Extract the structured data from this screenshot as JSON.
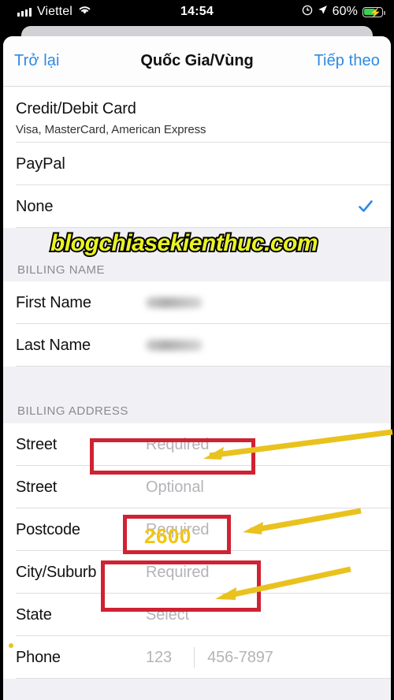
{
  "status_bar": {
    "carrier": "Viettel",
    "time": "14:54",
    "battery_percent": "60%",
    "signal_icon": "cellular-signal-icon",
    "wifi_icon": "wifi-icon",
    "alarm_icon": "orientation-lock-icon",
    "location_icon": "location-arrow-icon",
    "battery_icon": "battery-charging-icon",
    "battery_fill_color": "#3ad14f"
  },
  "nav": {
    "back_label": "Trở lại",
    "title": "Quốc Gia/Vùng",
    "next_label": "Tiếp theo",
    "tint_color": "#2e8ae6"
  },
  "payment_methods": [
    {
      "title": "Credit/Debit Card",
      "subtitle": "Visa, MasterCard, American Express",
      "selected": false
    },
    {
      "title": "PayPal",
      "subtitle": "",
      "selected": false
    },
    {
      "title": "None",
      "subtitle": "",
      "selected": true
    }
  ],
  "sections": {
    "billing_name": {
      "header": "BILLING NAME",
      "rows": [
        {
          "label": "First Name",
          "value": "",
          "placeholder": "",
          "blurred": true
        },
        {
          "label": "Last Name",
          "value": "",
          "placeholder": "",
          "blurred": true
        }
      ]
    },
    "billing_address": {
      "header": "BILLING ADDRESS",
      "rows": [
        {
          "label": "Street",
          "value": "",
          "placeholder": "Required"
        },
        {
          "label": "Street",
          "value": "",
          "placeholder": "Optional"
        },
        {
          "label": "Postcode",
          "value": "",
          "placeholder": "Required"
        },
        {
          "label": "City/Suburb",
          "value": "",
          "placeholder": "Required"
        },
        {
          "label": "State",
          "value": "",
          "placeholder": "Select"
        }
      ],
      "phone_row": {
        "label": "Phone",
        "area_placeholder": "123",
        "number_placeholder": "456-7897"
      }
    }
  },
  "annotations": {
    "postcode_overlay_value": "2600",
    "box_color": "#cf2233",
    "arrow_color": "#e9c21e",
    "highlighted_fields": [
      "Street",
      "Postcode",
      "City/Suburb"
    ]
  },
  "watermark": {
    "text": "blogchiasekienthuc.com",
    "fill_color": "#e9f321",
    "stroke_color": "#000000"
  }
}
